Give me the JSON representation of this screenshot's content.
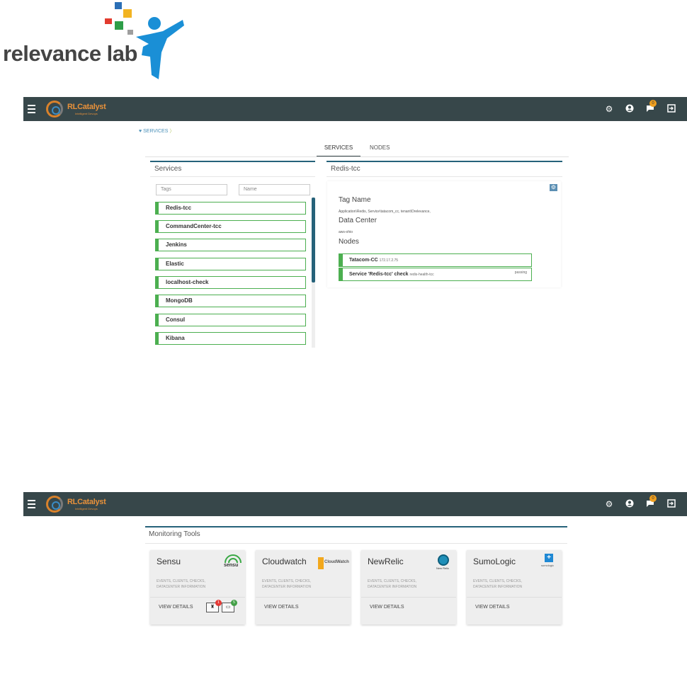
{
  "logo": {
    "text": "relevance lab"
  },
  "navbar": {
    "brand": "RLCatalyst",
    "brand_sub": "Intelligent Devops",
    "notif_count": "0"
  },
  "services_view": {
    "breadcrumb": "SERVICES",
    "tabs": [
      "SERVICES",
      "NODES"
    ],
    "left_title": "Services",
    "tags_placeholder": "Tags",
    "name_placeholder": "Name",
    "services": [
      "Redis-tcc",
      "CommandCenter-tcc",
      "Jenkins",
      "Elastic",
      "localhost-check",
      "MongoDB",
      "Consul",
      "Kibana"
    ],
    "right_title": "Redis-tcc",
    "tag_name_label": "Tag Name",
    "tag_name_value": "Application\\Redis, Service\\tatacom_cc, tenant\\Drelevance,",
    "datacenter_label": "Data Center",
    "datacenter_value": "aws-ohio",
    "nodes_label": "Nodes",
    "node_name": "Tatacom-CC",
    "node_ip": "172.17.2.75",
    "check_label": "Service 'Redis-tcc' check",
    "check_id": "redis-health-tcc",
    "check_status": "passing"
  },
  "monitoring": {
    "title": "Monitoring Tools",
    "cards": [
      {
        "name": "Sensu",
        "desc": "EVENTS, CLIENTS, CHECKS, DATACENTER INFORMATION",
        "button": "VIEW DETAILS",
        "logo": "sensu",
        "alert_count": "1",
        "ok_count": "5"
      },
      {
        "name": "Cloudwatch",
        "desc": "EVENTS, CLIENTS, CHECKS, DATACENTER INFORMATION",
        "button": "VIEW DETAILS",
        "logo": "CloudWatch"
      },
      {
        "name": "NewRelic",
        "desc": "EVENTS, CLIENTS, CHECKS, DATACENTER INFORMATION",
        "button": "VIEW DETAILS",
        "logo": "New Relic"
      },
      {
        "name": "SumoLogic",
        "desc": "EVENTS, CLIENTS, CHECKS, DATACENTER INFORMATION",
        "button": "VIEW DETAILS",
        "logo": "sumologic"
      }
    ]
  },
  "colors": {
    "navbar": "#37474a",
    "accent_green": "#4caf50",
    "panel_line": "#26627a",
    "brand_orange": "#e8913a"
  }
}
